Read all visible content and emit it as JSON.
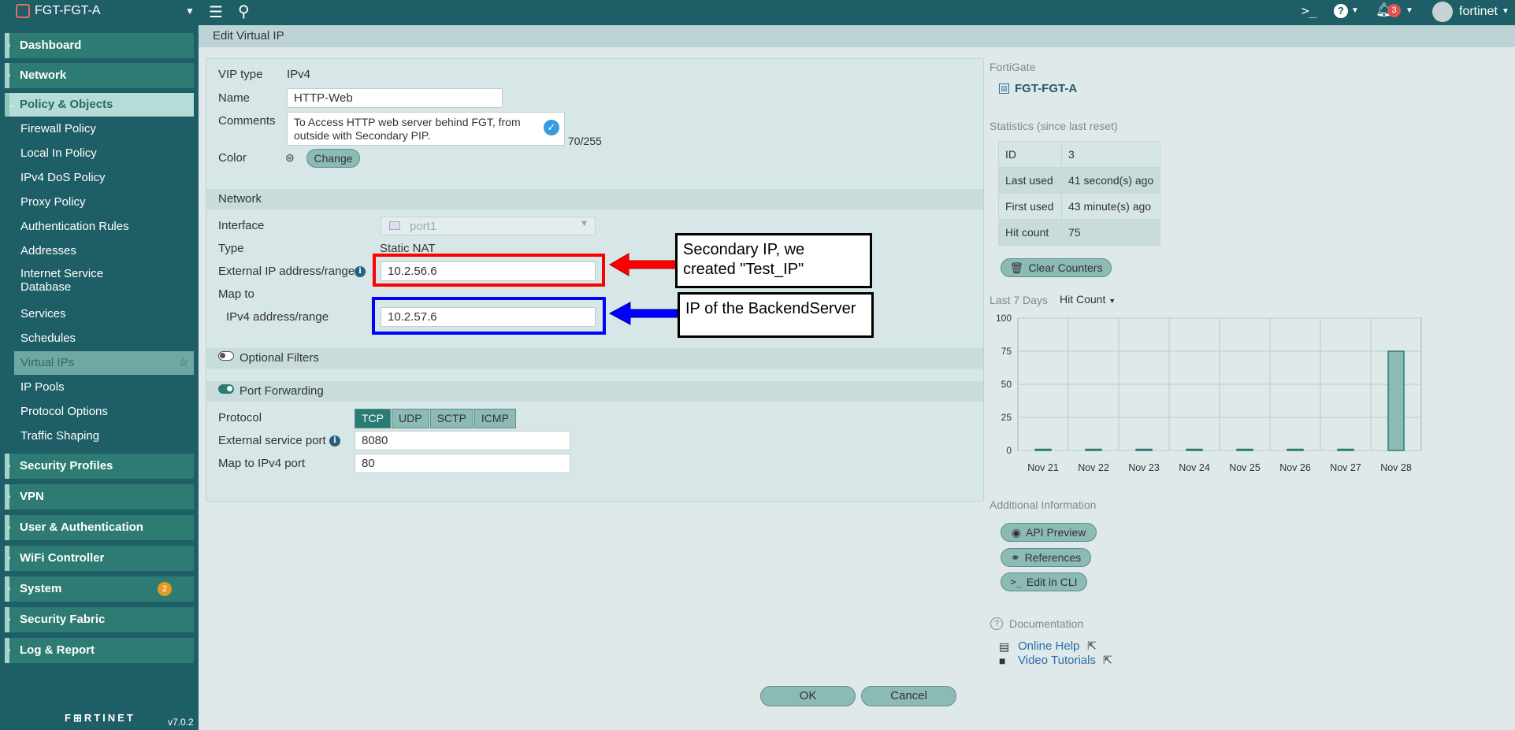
{
  "topbar": {
    "device_name": "FGT-FGT-A",
    "notification_count": "3",
    "user": "fortinet",
    "cli_symbol": ">_",
    "help_symbol": "?"
  },
  "sidebar": {
    "sections": [
      {
        "label": "Dashboard",
        "chevron": "›"
      },
      {
        "label": "Network",
        "chevron": "›"
      },
      {
        "label": "Policy & Objects",
        "chevron": "⌄"
      },
      {
        "label": "Security Profiles",
        "chevron": "›"
      },
      {
        "label": "VPN",
        "chevron": "›"
      },
      {
        "label": "User & Authentication",
        "chevron": "›"
      },
      {
        "label": "WiFi Controller",
        "chevron": "›"
      },
      {
        "label": "System",
        "chevron": "›",
        "badge": "2"
      },
      {
        "label": "Security Fabric",
        "chevron": "›"
      },
      {
        "label": "Log & Report",
        "chevron": "›"
      }
    ],
    "items": [
      {
        "label": "Firewall Policy"
      },
      {
        "label": "Local In Policy"
      },
      {
        "label": "IPv4 DoS Policy"
      },
      {
        "label": "Proxy Policy"
      },
      {
        "label": "Authentication Rules"
      },
      {
        "label": "Addresses"
      },
      {
        "label": "Internet Service Database"
      },
      {
        "label": "Services"
      },
      {
        "label": "Schedules"
      },
      {
        "label": "Virtual IPs"
      },
      {
        "label": "IP Pools"
      },
      {
        "label": "Protocol Options"
      },
      {
        "label": "Traffic Shaping"
      }
    ],
    "brand": "F⊞RTINET",
    "version": "v7.0.2"
  },
  "header": {
    "title": "Edit Virtual IP"
  },
  "form": {
    "vip_type_label": "VIP type",
    "vip_type_value": "IPv4",
    "name_label": "Name",
    "name_value": "HTTP-Web",
    "comments_label": "Comments",
    "comments_value": "To Access HTTP web server behind FGT, from outside with Secondary PIP.",
    "comments_counter": "70/255",
    "color_label": "Color",
    "color_button": "Change",
    "network_section": "Network",
    "interface_label": "Interface",
    "interface_value": "port1",
    "type_label": "Type",
    "type_value": "Static NAT",
    "ext_ip_label": "External IP address/range",
    "ext_ip_value": "10.2.56.6",
    "map_to_label": "Map to",
    "ipv4_range_label": "IPv4 address/range",
    "ipv4_range_value": "10.2.57.6",
    "optional_filters": "Optional Filters",
    "port_forwarding": "Port Forwarding",
    "protocol_label": "Protocol",
    "protocols": [
      "TCP",
      "UDP",
      "SCTP",
      "ICMP"
    ],
    "selected_protocol": "TCP",
    "ext_port_label": "External service port",
    "ext_port_value": "8080",
    "map_port_label": "Map to IPv4 port",
    "map_port_value": "80"
  },
  "annotations": {
    "secondary_ip_line1": "Secondary IP, we",
    "secondary_ip_line2": "created \"Test_IP\"",
    "backend": "IP of the BackendServer",
    "red_color": "#ff0000",
    "blue_color": "#0000ff"
  },
  "right": {
    "fortigate_label": "FortiGate",
    "fortigate_name": "FGT-FGT-A",
    "stats_title": "Statistics (since last reset)",
    "stats": [
      {
        "key": "ID",
        "value": "3"
      },
      {
        "key": "Last used",
        "value": "41 second(s) ago"
      },
      {
        "key": "First used",
        "value": "43 minute(s) ago"
      },
      {
        "key": "Hit count",
        "value": "75"
      }
    ],
    "clear_counters": "Clear Counters",
    "last7_label": "Last 7 Days",
    "hitcount_dropdown": "Hit Count",
    "additional_info": "Additional Information",
    "api_preview": "API Preview",
    "references": "References",
    "edit_cli": "Edit in CLI",
    "documentation": "Documentation",
    "online_help": "Online Help",
    "video_tutorials": "Video Tutorials"
  },
  "chart_data": {
    "type": "bar",
    "categories": [
      "Nov 21",
      "Nov 22",
      "Nov 23",
      "Nov 24",
      "Nov 25",
      "Nov 26",
      "Nov 27",
      "Nov 28"
    ],
    "values": [
      0,
      0,
      0,
      0,
      0,
      0,
      0,
      75
    ],
    "title": "",
    "xlabel": "",
    "ylabel": "",
    "ylim": [
      0,
      100
    ],
    "yticks": [
      0,
      25,
      50,
      75,
      100
    ],
    "grid": true,
    "bar_color": "#8cbab5"
  },
  "buttons": {
    "ok": "OK",
    "cancel": "Cancel"
  }
}
